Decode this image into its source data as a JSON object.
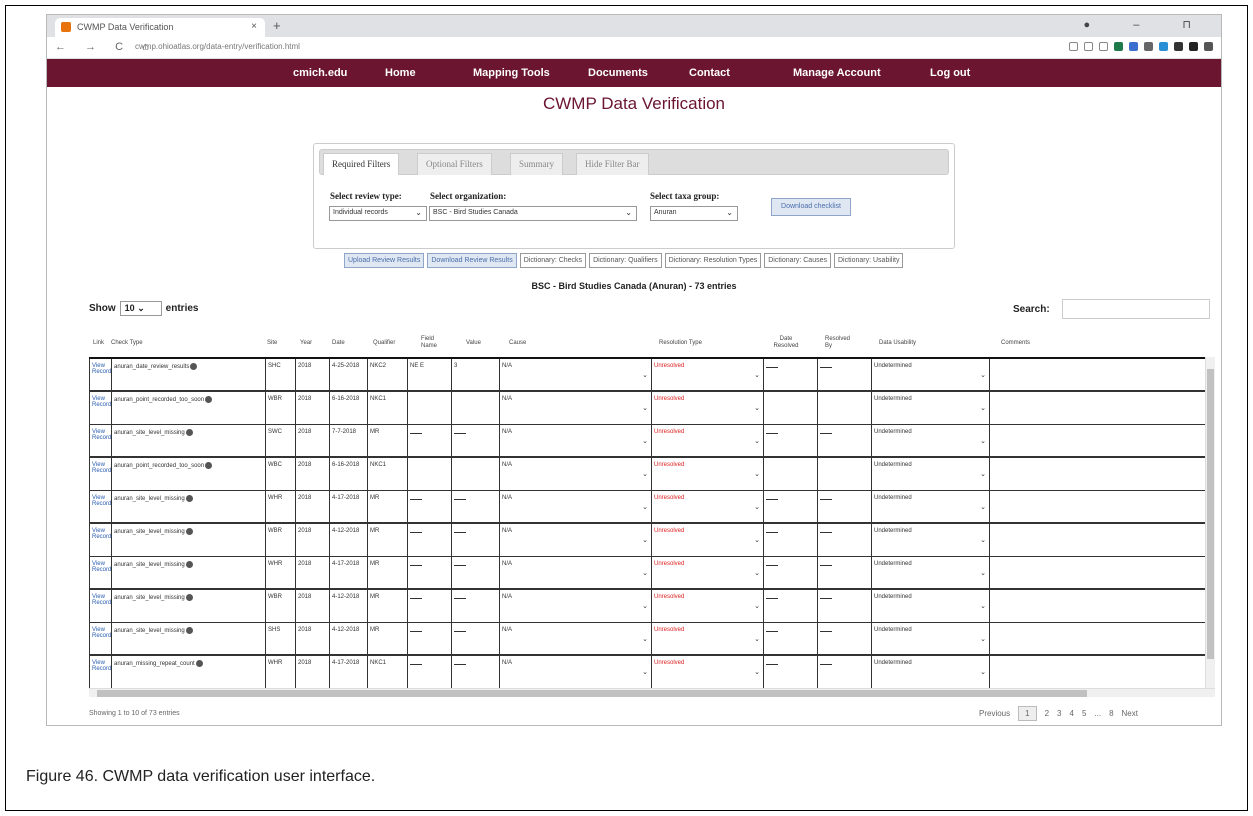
{
  "browser": {
    "tab_title": "CWMP Data Verification",
    "tab_close": "×",
    "new_tab": "+",
    "window_controls": "● – ⊓",
    "nav_buttons": "← → C ⌂",
    "url": "cwmp.ohioatlas.org/data-entry/verification.html"
  },
  "site_nav": {
    "items": [
      "cmich.edu",
      "Home",
      "Mapping Tools",
      "Documents",
      "Contact",
      "Manage Account",
      "Log out"
    ]
  },
  "page_title": "CWMP Data Verification",
  "filters": {
    "tabs": [
      "Required Filters",
      "Optional Filters",
      "Summary",
      "Hide Filter Bar"
    ],
    "review_type_label": "Select review type:",
    "review_type_value": "Individual records",
    "organization_label": "Select organization:",
    "organization_value": "BSC - Bird Studies Canada",
    "taxa_label": "Select taxa group:",
    "taxa_value": "Anuran",
    "download_button": "Download checklist"
  },
  "action_buttons": [
    "Upload Review Results",
    "Download Review Results",
    "Dictionary: Checks",
    "Dictionary: Qualifiers",
    "Dictionary: Resolution Types",
    "Dictionary: Causes",
    "Dictionary: Usability"
  ],
  "entries_title": "BSC - Bird Studies Canada (Anuran) - 73 entries",
  "show_entries": {
    "prefix": "Show",
    "value": "10",
    "suffix": "entries"
  },
  "search_label": "Search:",
  "table": {
    "headers": [
      "Link",
      "Check Type",
      "Site",
      "Year",
      "Date",
      "Qualifier",
      "Field Name",
      "Value",
      "Cause",
      "Resolution Type",
      "Date Resolved",
      "Resolved By",
      "Data Usability",
      "Comments"
    ],
    "rows": [
      {
        "link": "View Record",
        "check": "anuran_date_review_results",
        "site": "SHC",
        "year": "2018",
        "date": "4-25-2018",
        "qual": "NKC2",
        "field": "NE E",
        "value": "3",
        "cause": "N/A",
        "res": "Unresolved",
        "usab": "Undetermined"
      },
      {
        "link": "View Record",
        "check": "anuran_point_recorded_too_soon",
        "site": "WBR",
        "year": "2018",
        "date": "6-16-2018",
        "qual": "NKC1",
        "field": "",
        "value": "",
        "cause": "N/A",
        "res": "Unresolved",
        "usab": "Undetermined"
      },
      {
        "link": "View Record",
        "check": "anuran_site_level_missing",
        "site": "SWC",
        "year": "2018",
        "date": "7-7-2018",
        "qual": "MR",
        "field": "",
        "value": "",
        "cause": "N/A",
        "res": "Unresolved",
        "usab": "Undetermined"
      },
      {
        "link": "View Record",
        "check": "anuran_point_recorded_too_soon",
        "site": "WBC",
        "year": "2018",
        "date": "6-16-2018",
        "qual": "NKC1",
        "field": "",
        "value": "",
        "cause": "N/A",
        "res": "Unresolved",
        "usab": "Undetermined"
      },
      {
        "link": "View Record",
        "check": "anuran_site_level_missing",
        "site": "WHR",
        "year": "2018",
        "date": "4-17-2018",
        "qual": "MR",
        "field": "",
        "value": "",
        "cause": "N/A",
        "res": "Unresolved",
        "usab": "Undetermined"
      },
      {
        "link": "View Record",
        "check": "anuran_site_level_missing",
        "site": "WBR",
        "year": "2018",
        "date": "4-12-2018",
        "qual": "MR",
        "field": "",
        "value": "",
        "cause": "N/A",
        "res": "Unresolved",
        "usab": "Undetermined"
      },
      {
        "link": "View Record",
        "check": "anuran_site_level_missing",
        "site": "WHR",
        "year": "2018",
        "date": "4-17-2018",
        "qual": "MR",
        "field": "",
        "value": "",
        "cause": "N/A",
        "res": "Unresolved",
        "usab": "Undetermined"
      },
      {
        "link": "View Record",
        "check": "anuran_site_level_missing",
        "site": "WBR",
        "year": "2018",
        "date": "4-12-2018",
        "qual": "MR",
        "field": "",
        "value": "",
        "cause": "N/A",
        "res": "Unresolved",
        "usab": "Undetermined"
      },
      {
        "link": "View Record",
        "check": "anuran_site_level_missing",
        "site": "SHS",
        "year": "2018",
        "date": "4-12-2018",
        "qual": "MR",
        "field": "",
        "value": "",
        "cause": "N/A",
        "res": "Unresolved",
        "usab": "Undetermined"
      },
      {
        "link": "View Record",
        "check": "anuran_missing_repeat_count",
        "site": "WHR",
        "year": "2018",
        "date": "4-17-2018",
        "qual": "NKC1",
        "field": "",
        "value": "",
        "cause": "N/A",
        "res": "Unresolved",
        "usab": "Undetermined"
      }
    ]
  },
  "footer": {
    "info": "Showing 1 to 10 of 73 entries",
    "previous": "Previous",
    "pages": [
      "1",
      "2",
      "3",
      "4",
      "5",
      "...",
      "8"
    ],
    "next": "Next"
  },
  "caption": "Figure 46. CWMP data verification user interface.",
  "colors": {
    "nav_maroon": "#6b1530",
    "unresolved_red": "#dd2222",
    "link_blue": "#2a5db0"
  }
}
